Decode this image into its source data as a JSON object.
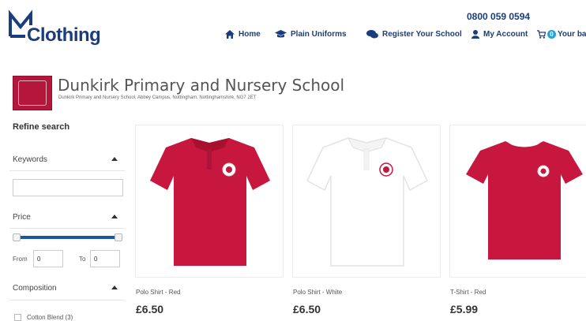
{
  "header": {
    "logo_text": "Clothing",
    "phone": "0800 059 0594",
    "nav": [
      {
        "label": "Home",
        "icon": "home-icon"
      },
      {
        "label": "Plain Uniforms",
        "icon": "graduation-cap-icon"
      },
      {
        "label": "Register Your School",
        "icon": "chat-icon"
      },
      {
        "label": "My Account",
        "icon": "user-icon"
      },
      {
        "label": "Your ba",
        "icon": "cart-icon",
        "badge": "0"
      }
    ]
  },
  "school": {
    "name": "Dunkirk Primary and Nursery School",
    "address": "Dunkirk Primary and Nursery School, Abbey Campus, Nottingham, Nottinghamshire, NG7 2ET"
  },
  "sidebar": {
    "title": "Refine search",
    "keywords_label": "Keywords",
    "keywords_value": "",
    "price_label": "Price",
    "from_label": "From",
    "from_value": "0",
    "to_label": "To",
    "to_value": "0",
    "composition_label": "Composition",
    "composition_options": [
      {
        "label": "Cotton Blend (3)",
        "checked": false
      }
    ]
  },
  "products": [
    {
      "name": "Polo Shirt - Red",
      "price": "£6.50",
      "color": "#c8173e"
    },
    {
      "name": "Polo Shirt - White",
      "price": "£6.50",
      "color": "#ffffff"
    },
    {
      "name": "T-Shirt - Red",
      "price": "£5.99",
      "color": "#c8173e"
    }
  ],
  "colors": {
    "brand_navy": "#1a3d7c",
    "accent_blue": "#2a9fd8",
    "shirt_red": "#c8173e"
  }
}
